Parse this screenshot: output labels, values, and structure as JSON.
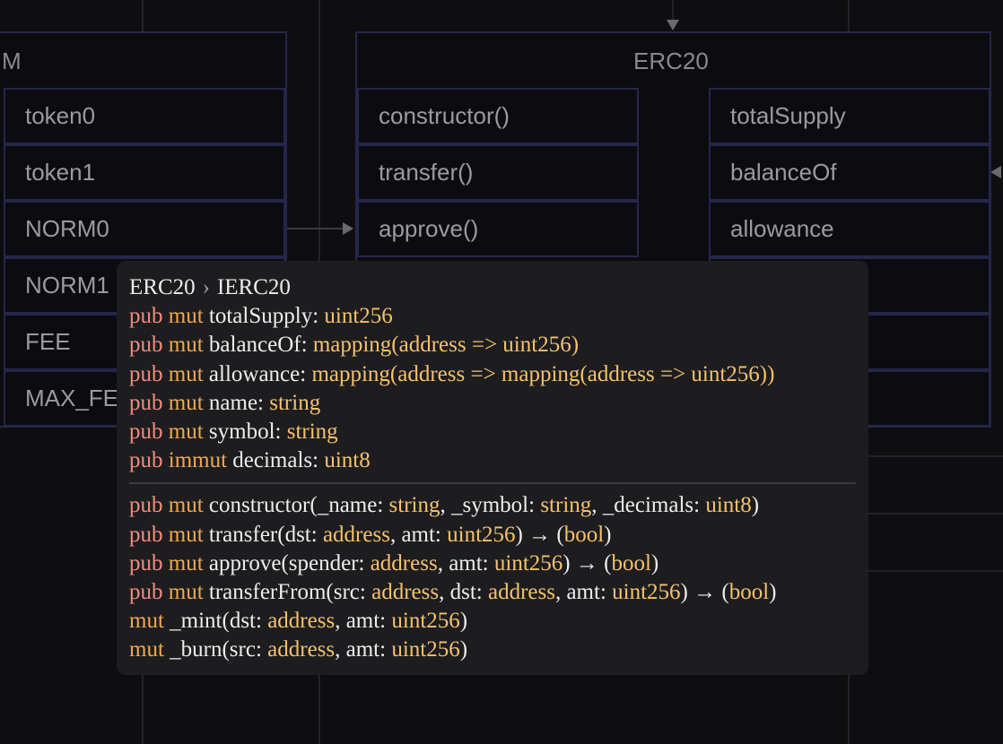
{
  "diagram": {
    "left_box": {
      "title": "M",
      "rows": [
        "token0",
        "token1",
        "NORM0",
        "NORM1",
        "FEE",
        "MAX_FE"
      ]
    },
    "erc20_box": {
      "title": "ERC20",
      "methods": [
        "constructor()",
        "transfer()",
        "approve()"
      ],
      "fields": [
        "totalSupply",
        "balanceOf",
        "allowance"
      ]
    }
  },
  "tooltip": {
    "breadcrumb": [
      "ERC20",
      "IERC20"
    ],
    "fields": [
      [
        {
          "t": "pub",
          "c": "pub"
        },
        {
          "t": " "
        },
        {
          "t": "mut",
          "c": "mut"
        },
        {
          "t": " totalSupply: "
        },
        {
          "t": "uint256",
          "c": "ty"
        }
      ],
      [
        {
          "t": "pub",
          "c": "pub"
        },
        {
          "t": " "
        },
        {
          "t": "mut",
          "c": "mut"
        },
        {
          "t": " balanceOf: "
        },
        {
          "t": "mapping(address => uint256)",
          "c": "ty"
        }
      ],
      [
        {
          "t": "pub",
          "c": "pub"
        },
        {
          "t": " "
        },
        {
          "t": "mut",
          "c": "mut"
        },
        {
          "t": " allowance: "
        },
        {
          "t": "mapping(address => mapping(address => uint256))",
          "c": "ty"
        }
      ],
      [
        {
          "t": "pub",
          "c": "pub"
        },
        {
          "t": " "
        },
        {
          "t": "mut",
          "c": "mut"
        },
        {
          "t": " name: "
        },
        {
          "t": "string",
          "c": "ty"
        }
      ],
      [
        {
          "t": "pub",
          "c": "pub"
        },
        {
          "t": " "
        },
        {
          "t": "mut",
          "c": "mut"
        },
        {
          "t": " symbol: "
        },
        {
          "t": "string",
          "c": "ty"
        }
      ],
      [
        {
          "t": "pub",
          "c": "pub"
        },
        {
          "t": " "
        },
        {
          "t": "immut",
          "c": "mut"
        },
        {
          "t": " decimals: "
        },
        {
          "t": "uint8",
          "c": "ty"
        }
      ]
    ],
    "methods": [
      [
        {
          "t": "pub",
          "c": "pub"
        },
        {
          "t": " "
        },
        {
          "t": "mut",
          "c": "mut"
        },
        {
          "t": " constructor(_name: "
        },
        {
          "t": "string",
          "c": "ty"
        },
        {
          "t": ", _symbol: "
        },
        {
          "t": "string",
          "c": "ty"
        },
        {
          "t": ", _decimals: "
        },
        {
          "t": "uint8",
          "c": "ty"
        },
        {
          "t": ")"
        }
      ],
      [
        {
          "t": "pub",
          "c": "pub"
        },
        {
          "t": " "
        },
        {
          "t": "mut",
          "c": "mut"
        },
        {
          "t": " transfer(dst: "
        },
        {
          "t": "address",
          "c": "ty"
        },
        {
          "t": ", amt: "
        },
        {
          "t": "uint256",
          "c": "ty"
        },
        {
          "t": ") → ("
        },
        {
          "t": "bool",
          "c": "ty"
        },
        {
          "t": ")"
        }
      ],
      [
        {
          "t": "pub",
          "c": "pub"
        },
        {
          "t": " "
        },
        {
          "t": "mut",
          "c": "mut"
        },
        {
          "t": " approve(spender: "
        },
        {
          "t": "address",
          "c": "ty"
        },
        {
          "t": ", amt: "
        },
        {
          "t": "uint256",
          "c": "ty"
        },
        {
          "t": ") → ("
        },
        {
          "t": "bool",
          "c": "ty"
        },
        {
          "t": ")"
        }
      ],
      [
        {
          "t": "pub",
          "c": "pub"
        },
        {
          "t": " "
        },
        {
          "t": "mut",
          "c": "mut"
        },
        {
          "t": " transferFrom(src: "
        },
        {
          "t": "address",
          "c": "ty"
        },
        {
          "t": ", dst: "
        },
        {
          "t": "address",
          "c": "ty"
        },
        {
          "t": ", amt: "
        },
        {
          "t": "uint256",
          "c": "ty"
        },
        {
          "t": ") → ("
        },
        {
          "t": "bool",
          "c": "ty"
        },
        {
          "t": ")"
        }
      ],
      [
        {
          "t": "mut",
          "c": "mut"
        },
        {
          "t": " _mint(dst: "
        },
        {
          "t": "address",
          "c": "ty"
        },
        {
          "t": ", amt: "
        },
        {
          "t": "uint256",
          "c": "ty"
        },
        {
          "t": ")"
        }
      ],
      [
        {
          "t": "mut",
          "c": "mut"
        },
        {
          "t": " _burn(src: "
        },
        {
          "t": "address",
          "c": "ty"
        },
        {
          "t": ", amt: "
        },
        {
          "t": "uint256",
          "c": "ty"
        },
        {
          "t": ")"
        }
      ]
    ]
  }
}
